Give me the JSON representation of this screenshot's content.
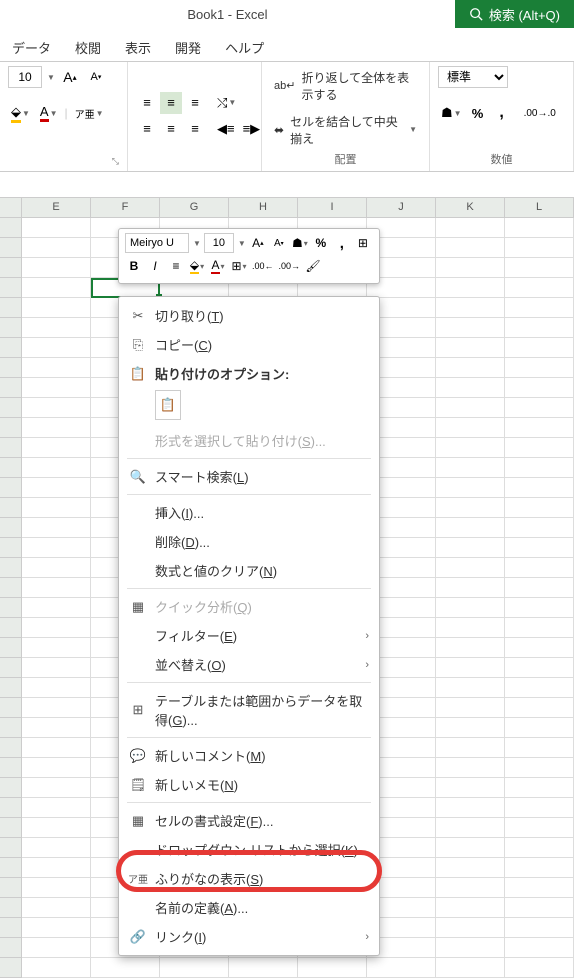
{
  "title": "Book1  -  Excel",
  "search": {
    "label": "検索 (Alt+Q)"
  },
  "tabs": [
    "データ",
    "校閲",
    "表示",
    "開発",
    "ヘルプ"
  ],
  "ribbon": {
    "font": {
      "size": "10",
      "group_label": ""
    },
    "align": {
      "group_label": "配置"
    },
    "wrap": {
      "wrap_label": "折り返して全体を表示する",
      "merge_label": "セルを結合して中央揃え"
    },
    "number": {
      "format": "標準",
      "group_label": "数値"
    }
  },
  "columns": [
    "E",
    "F",
    "G",
    "H",
    "I",
    "J",
    "K",
    "L"
  ],
  "mini": {
    "font": "Meiryo U",
    "size": "10"
  },
  "menu": {
    "cut": "切り取り(T)",
    "copy": "コピー(C)",
    "paste_opts": "貼り付けのオプション:",
    "paste_special": "形式を選択して貼り付け(S)...",
    "smart_lookup": "スマート検索(L)",
    "insert": "挿入(I)...",
    "delete": "削除(D)...",
    "clear": "数式と値のクリア(N)",
    "quick": "クイック分析(Q)",
    "filter": "フィルター(E)",
    "sort": "並べ替え(O)",
    "table_data": "テーブルまたは範囲からデータを取得(G)...",
    "new_comment": "新しいコメント(M)",
    "new_note": "新しいメモ(N)",
    "format_cells": "セルの書式設定(F)...",
    "dropdown": "ドロップダウン リストから選択(K)...",
    "furigana": "ふりがなの表示(S)",
    "define_name": "名前の定義(A)...",
    "link": "リンク(I)"
  }
}
